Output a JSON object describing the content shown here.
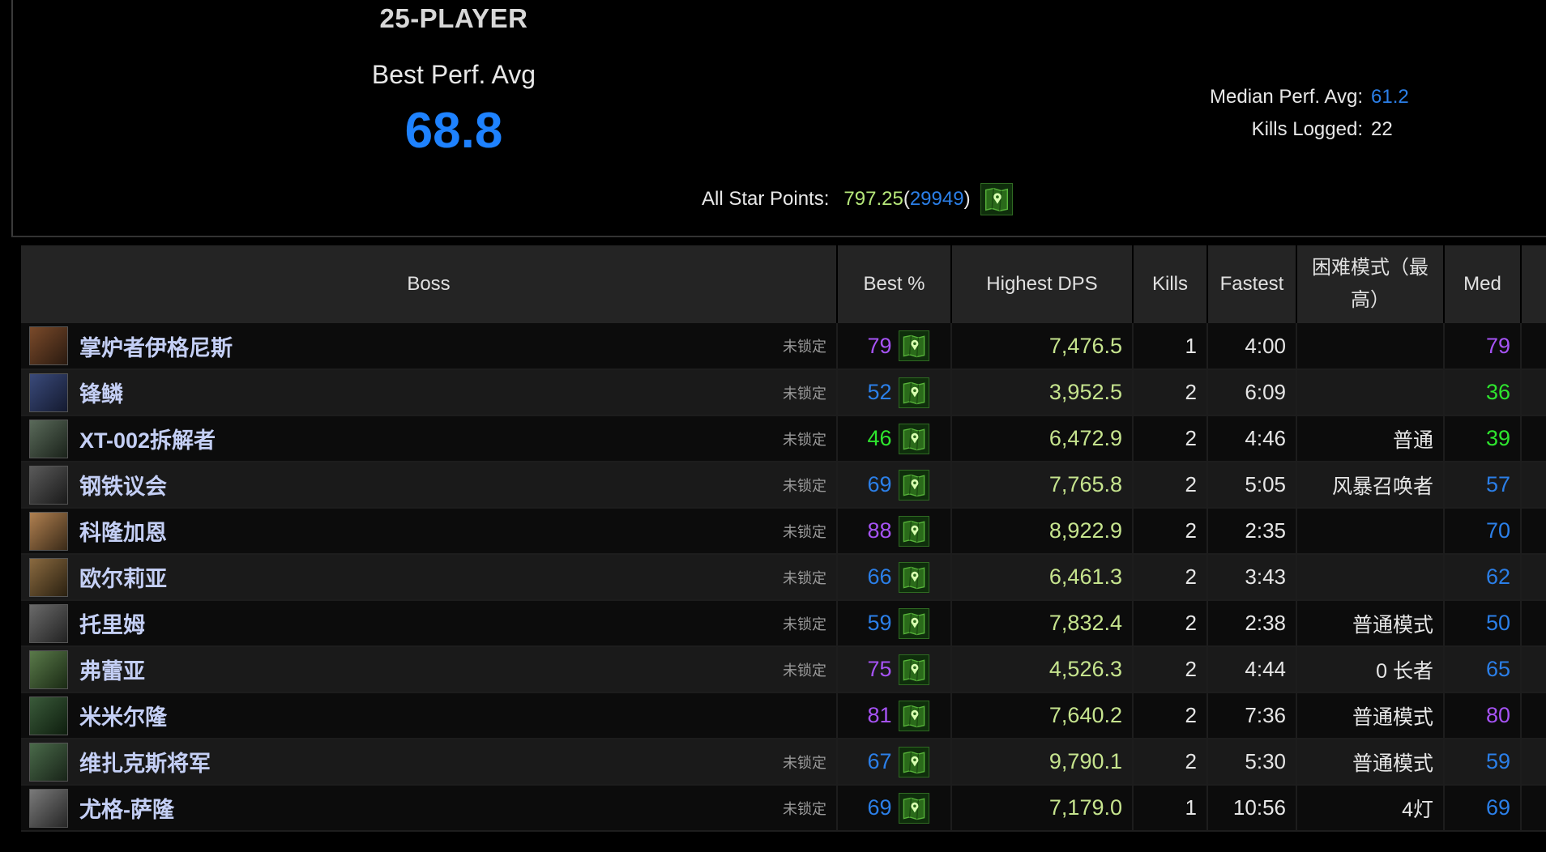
{
  "header": {
    "title": "25-PLAYER",
    "best_perf_label": "Best Perf. Avg",
    "best_perf_value": "68.8",
    "median_label": "Median Perf. Avg:",
    "median_value": "61.2",
    "kills_label": "Kills Logged:",
    "kills_value": "22",
    "star_points_label": "All Star Points:",
    "star_points_value": "797.25",
    "star_points_open": "(",
    "star_points_rank": "29949",
    "star_points_close": ")"
  },
  "colors": {
    "accent_blue": "#1e82ff",
    "parse_purple": "#a653f5",
    "parse_blue": "#2b7fe8",
    "parse_green": "#2ee62e",
    "dps_green": "#c6e48e",
    "boss_name": "#c4cff5"
  },
  "icons": {
    "ranking_button": "map-marker-icon",
    "boss_portrait": "boss-portrait-icon"
  },
  "table": {
    "columns": {
      "boss": "Boss",
      "best": "Best %",
      "dps": "Highest DPS",
      "kills": "Kills",
      "fastest": "Fastest",
      "hard": "困难模式（最高）",
      "med": "Med"
    },
    "rows": [
      {
        "boss": "掌炉者伊格尼斯",
        "status": "未锁定",
        "best": "79",
        "best_tier": "purple",
        "dps": "7,476.5",
        "kills": "1",
        "fastest": "4:00",
        "hard": "",
        "med": "79",
        "med_tier": "purple"
      },
      {
        "boss": "锋鳞",
        "status": "未锁定",
        "best": "52",
        "best_tier": "blue",
        "dps": "3,952.5",
        "kills": "2",
        "fastest": "6:09",
        "hard": "",
        "med": "36",
        "med_tier": "green"
      },
      {
        "boss": "XT-002拆解者",
        "status": "未锁定",
        "best": "46",
        "best_tier": "green",
        "dps": "6,472.9",
        "kills": "2",
        "fastest": "4:46",
        "hard": "普通",
        "med": "39",
        "med_tier": "green"
      },
      {
        "boss": "钢铁议会",
        "status": "未锁定",
        "best": "69",
        "best_tier": "blue",
        "dps": "7,765.8",
        "kills": "2",
        "fastest": "5:05",
        "hard": "风暴召唤者",
        "med": "57",
        "med_tier": "blue"
      },
      {
        "boss": "科隆加恩",
        "status": "未锁定",
        "best": "88",
        "best_tier": "purple",
        "dps": "8,922.9",
        "kills": "2",
        "fastest": "2:35",
        "hard": "",
        "med": "70",
        "med_tier": "blue"
      },
      {
        "boss": "欧尔莉亚",
        "status": "未锁定",
        "best": "66",
        "best_tier": "blue",
        "dps": "6,461.3",
        "kills": "2",
        "fastest": "3:43",
        "hard": "",
        "med": "62",
        "med_tier": "blue"
      },
      {
        "boss": "托里姆",
        "status": "未锁定",
        "best": "59",
        "best_tier": "blue",
        "dps": "7,832.4",
        "kills": "2",
        "fastest": "2:38",
        "hard": "普通模式",
        "med": "50",
        "med_tier": "blue"
      },
      {
        "boss": "弗蕾亚",
        "status": "未锁定",
        "best": "75",
        "best_tier": "purple",
        "dps": "4,526.3",
        "kills": "2",
        "fastest": "4:44",
        "hard": "0 长者",
        "med": "65",
        "med_tier": "blue"
      },
      {
        "boss": "米米尔隆",
        "status": "",
        "best": "81",
        "best_tier": "purple",
        "dps": "7,640.2",
        "kills": "2",
        "fastest": "7:36",
        "hard": "普通模式",
        "med": "80",
        "med_tier": "purple"
      },
      {
        "boss": "维扎克斯将军",
        "status": "未锁定",
        "best": "67",
        "best_tier": "blue",
        "dps": "9,790.1",
        "kills": "2",
        "fastest": "5:30",
        "hard": "普通模式",
        "med": "59",
        "med_tier": "blue"
      },
      {
        "boss": "尤格-萨隆",
        "status": "未锁定",
        "best": "69",
        "best_tier": "blue",
        "dps": "7,179.0",
        "kills": "1",
        "fastest": "10:56",
        "hard": "4灯",
        "med": "69",
        "med_tier": "blue"
      }
    ]
  }
}
